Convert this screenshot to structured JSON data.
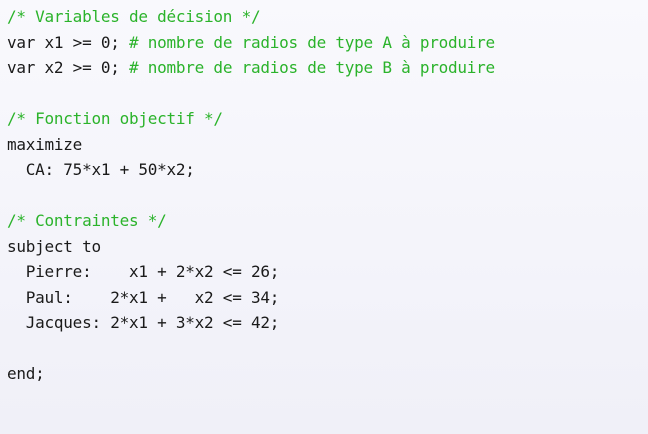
{
  "code": {
    "lines": [
      {
        "code": "",
        "comment": "/* Variables de décision */"
      },
      {
        "code": "var x1 >= 0; ",
        "comment": "# nombre de radios de type A à produire"
      },
      {
        "code": "var x2 >= 0; ",
        "comment": "# nombre de radios de type B à produire"
      },
      {
        "code": "",
        "comment": ""
      },
      {
        "code": "",
        "comment": "/* Fonction objectif */"
      },
      {
        "code": "maximize",
        "comment": ""
      },
      {
        "code": "  CA: 75*x1 + 50*x2;",
        "comment": ""
      },
      {
        "code": "",
        "comment": ""
      },
      {
        "code": "",
        "comment": "/* Contraintes */"
      },
      {
        "code": "subject to",
        "comment": ""
      },
      {
        "code": "  Pierre:    x1 + 2*x2 <= 26;",
        "comment": ""
      },
      {
        "code": "  Paul:    2*x1 +   x2 <= 34;",
        "comment": ""
      },
      {
        "code": "  Jacques: 2*x1 + 3*x2 <= 42;",
        "comment": ""
      },
      {
        "code": "",
        "comment": ""
      },
      {
        "code": "end;",
        "comment": ""
      }
    ]
  }
}
